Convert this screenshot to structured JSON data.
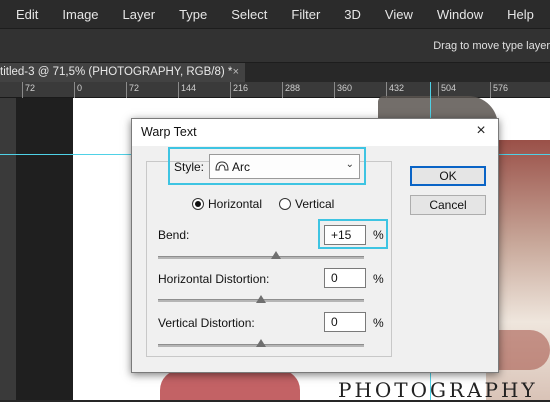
{
  "menu": [
    "Edit",
    "Image",
    "Layer",
    "Type",
    "Select",
    "Filter",
    "3D",
    "View",
    "Window",
    "Help"
  ],
  "options_bar": {
    "hint": "Drag to move type layer"
  },
  "document_tab": {
    "title": "titled-3 @ 71,5% (PHOTOGRAPHY, RGB/8) *",
    "close": "×"
  },
  "ruler": {
    "labels": [
      "72",
      "0",
      "72",
      "144",
      "216",
      "288",
      "360",
      "432",
      "504",
      "576"
    ]
  },
  "canvas": {
    "text": "PHOTOGRAPHY"
  },
  "dialog": {
    "title": "Warp Text",
    "close_icon": "×",
    "style_label": "Style:",
    "style_value": "Arc",
    "style_icon": "arc-icon",
    "orientation": {
      "options": [
        "Horizontal",
        "Vertical"
      ],
      "selected": "Horizontal"
    },
    "bend": {
      "label": "Bend:",
      "value": "+15",
      "unit": "%",
      "slider_fraction": 0.575
    },
    "h_distortion": {
      "label": "Horizontal Distortion:",
      "value": "0",
      "unit": "%",
      "slider_fraction": 0.5
    },
    "v_distortion": {
      "label": "Vertical Distortion:",
      "value": "0",
      "unit": "%",
      "slider_fraction": 0.5
    },
    "ok": "OK",
    "cancel": "Cancel"
  },
  "colors": {
    "highlight": "#3ec4e2",
    "guide": "#4fd1e6",
    "app_bg": "#262626"
  }
}
